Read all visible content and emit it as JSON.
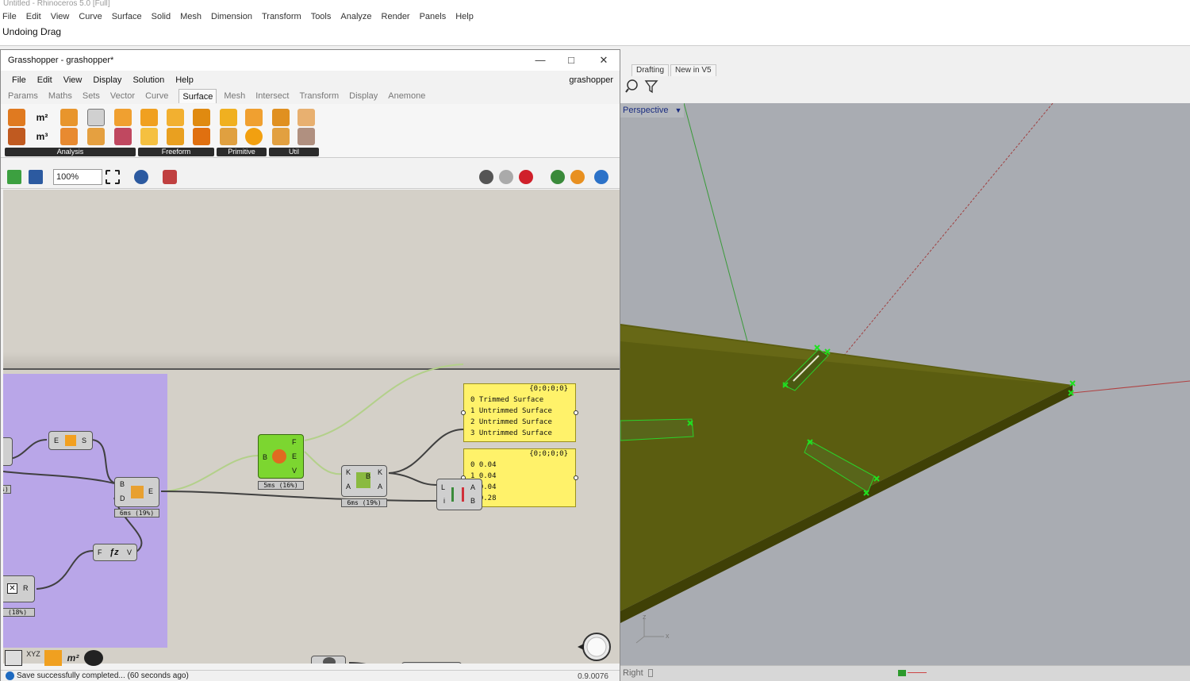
{
  "rhino": {
    "title": "Untitled - Rhinoceros 5.0 [Full]",
    "menu": [
      "File",
      "Edit",
      "View",
      "Curve",
      "Surface",
      "Solid",
      "Mesh",
      "Dimension",
      "Transform",
      "Tools",
      "Analyze",
      "Render",
      "Panels",
      "Help"
    ],
    "command_line": "Undoing Drag",
    "tabs": [
      "Drafting",
      "New in V5"
    ],
    "viewport_name": "Perspective",
    "bottom_tab": "Right"
  },
  "gh": {
    "title": "Grasshopper - grashopper*",
    "menu": [
      "File",
      "Edit",
      "View",
      "Display",
      "Solution",
      "Help"
    ],
    "file_name": "grashopper",
    "tabs": [
      "Params",
      "Maths",
      "Sets",
      "Vector",
      "Curve",
      "Surface",
      "Mesh",
      "Intersect",
      "Transform",
      "Display",
      "Anemone"
    ],
    "active_tab": "Surface",
    "ribbon_groups": [
      "Analysis",
      "Freeform",
      "Primitive",
      "Util"
    ],
    "zoom": "100%",
    "status": "Save successfully completed... (60 seconds ago)",
    "version": "0.9.0076"
  },
  "canvas": {
    "panel1": {
      "header": "{0;0;0;0}",
      "rows": [
        "0 Trimmed Surface",
        "1 Untrimmed Surface",
        "2 Untrimmed Surface",
        "3 Untrimmed Surface"
      ]
    },
    "panel2": {
      "header": "{0;0;0;0}",
      "rows": [
        "0 0.04",
        "1 0.04",
        "2 0.04",
        "3 0.28"
      ]
    },
    "comp_es": {
      "in": "E",
      "out": "S"
    },
    "comp_bd": {
      "in1": "B",
      "in2": "D",
      "out": "E",
      "timing": "6ms (19%)"
    },
    "comp_fv": {
      "in": "F",
      "out": "V"
    },
    "comp_bfev": {
      "in": "B",
      "out1": "F",
      "out2": "E",
      "out3": "V",
      "timing": "5ms (16%)"
    },
    "comp_kaka": {
      "in1": "K",
      "in2": "A",
      "mid": "B",
      "out1": "K",
      "out2": "A",
      "timing": "6ms (19%)"
    },
    "comp_liab": {
      "in1": "L",
      "in2": "i",
      "out1": "A",
      "out2": "B"
    },
    "comp_xr": {
      "out": "R",
      "timing": "(18%)"
    },
    "left_timing": "s)"
  }
}
